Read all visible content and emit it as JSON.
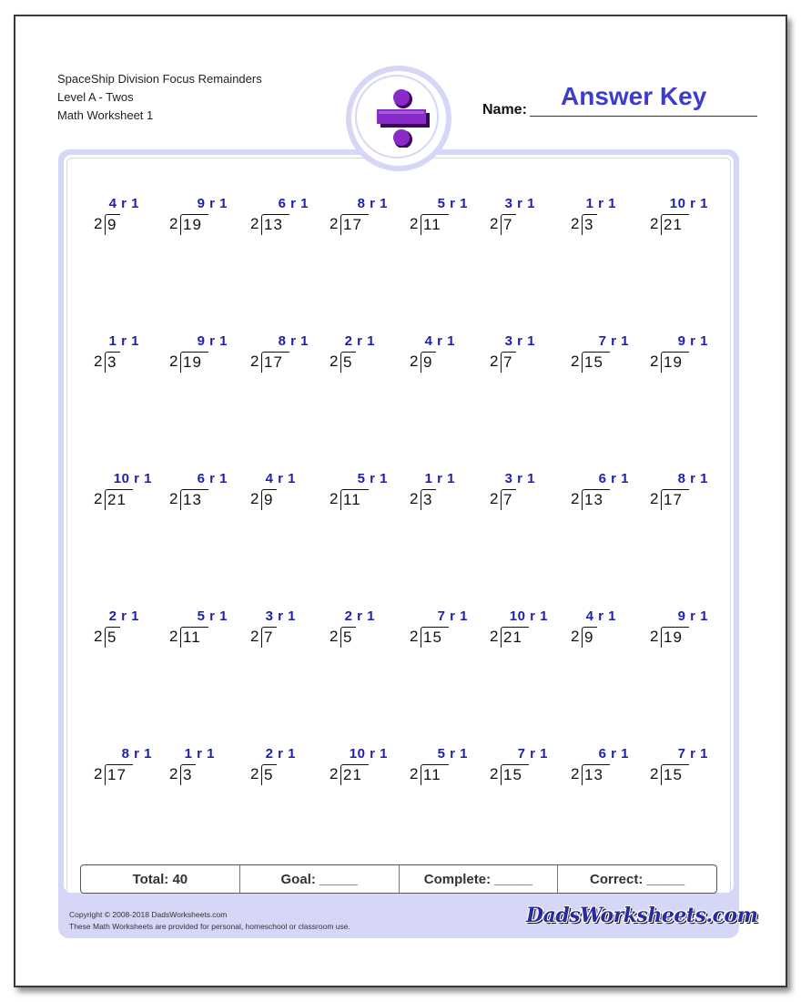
{
  "header": {
    "title": "SpaceShip Division Focus Remainders",
    "level": "Level A - Twos",
    "worksheet": "Math Worksheet 1",
    "name_label": "Name:",
    "name_value": "Answer Key"
  },
  "logo": {
    "icon": "division-sign-icon",
    "color": "#6a0dad"
  },
  "colors": {
    "answer": "#1f1fae",
    "name_value": "#3c3cd0",
    "frame": "#d6d6f6"
  },
  "problems": [
    [
      {
        "divisor": "2",
        "dividend": "9",
        "answer": "4 r 1"
      },
      {
        "divisor": "2",
        "dividend": "19",
        "answer": "9 r 1"
      },
      {
        "divisor": "2",
        "dividend": "13",
        "answer": "6 r 1"
      },
      {
        "divisor": "2",
        "dividend": "17",
        "answer": "8 r 1"
      },
      {
        "divisor": "2",
        "dividend": "11",
        "answer": "5 r 1"
      },
      {
        "divisor": "2",
        "dividend": "7",
        "answer": "3 r 1"
      },
      {
        "divisor": "2",
        "dividend": "3",
        "answer": "1 r 1"
      },
      {
        "divisor": "2",
        "dividend": "21",
        "answer": "10 r 1"
      }
    ],
    [
      {
        "divisor": "2",
        "dividend": "3",
        "answer": "1 r 1"
      },
      {
        "divisor": "2",
        "dividend": "19",
        "answer": "9 r 1"
      },
      {
        "divisor": "2",
        "dividend": "17",
        "answer": "8 r 1"
      },
      {
        "divisor": "2",
        "dividend": "5",
        "answer": "2 r 1"
      },
      {
        "divisor": "2",
        "dividend": "9",
        "answer": "4 r 1"
      },
      {
        "divisor": "2",
        "dividend": "7",
        "answer": "3 r 1"
      },
      {
        "divisor": "2",
        "dividend": "15",
        "answer": "7 r 1"
      },
      {
        "divisor": "2",
        "dividend": "19",
        "answer": "9 r 1"
      }
    ],
    [
      {
        "divisor": "2",
        "dividend": "21",
        "answer": "10 r 1"
      },
      {
        "divisor": "2",
        "dividend": "13",
        "answer": "6 r 1"
      },
      {
        "divisor": "2",
        "dividend": "9",
        "answer": "4 r 1"
      },
      {
        "divisor": "2",
        "dividend": "11",
        "answer": "5 r 1"
      },
      {
        "divisor": "2",
        "dividend": "3",
        "answer": "1 r 1"
      },
      {
        "divisor": "2",
        "dividend": "7",
        "answer": "3 r 1"
      },
      {
        "divisor": "2",
        "dividend": "13",
        "answer": "6 r 1"
      },
      {
        "divisor": "2",
        "dividend": "17",
        "answer": "8 r 1"
      }
    ],
    [
      {
        "divisor": "2",
        "dividend": "5",
        "answer": "2 r 1"
      },
      {
        "divisor": "2",
        "dividend": "11",
        "answer": "5 r 1"
      },
      {
        "divisor": "2",
        "dividend": "7",
        "answer": "3 r 1"
      },
      {
        "divisor": "2",
        "dividend": "5",
        "answer": "2 r 1"
      },
      {
        "divisor": "2",
        "dividend": "15",
        "answer": "7 r 1"
      },
      {
        "divisor": "2",
        "dividend": "21",
        "answer": "10 r 1"
      },
      {
        "divisor": "2",
        "dividend": "9",
        "answer": "4 r 1"
      },
      {
        "divisor": "2",
        "dividend": "19",
        "answer": "9 r 1"
      }
    ],
    [
      {
        "divisor": "2",
        "dividend": "17",
        "answer": "8 r 1"
      },
      {
        "divisor": "2",
        "dividend": "3",
        "answer": "1 r 1"
      },
      {
        "divisor": "2",
        "dividend": "5",
        "answer": "2 r 1"
      },
      {
        "divisor": "2",
        "dividend": "21",
        "answer": "10 r 1"
      },
      {
        "divisor": "2",
        "dividend": "11",
        "answer": "5 r 1"
      },
      {
        "divisor": "2",
        "dividend": "15",
        "answer": "7 r 1"
      },
      {
        "divisor": "2",
        "dividend": "13",
        "answer": "6 r 1"
      },
      {
        "divisor": "2",
        "dividend": "15",
        "answer": "7 r 1"
      }
    ]
  ],
  "score_bar": {
    "total": "Total: 40",
    "goal": "Goal: _____",
    "complete": "Complete: _____",
    "correct": "Correct: _____"
  },
  "footer": {
    "copyright": "Copyright © 2008-2018 DadsWorksheets.com",
    "usage": "These Math Worksheets are provided for personal, homeschool or classroom use.",
    "brand": "DadsWorksheets.com"
  }
}
